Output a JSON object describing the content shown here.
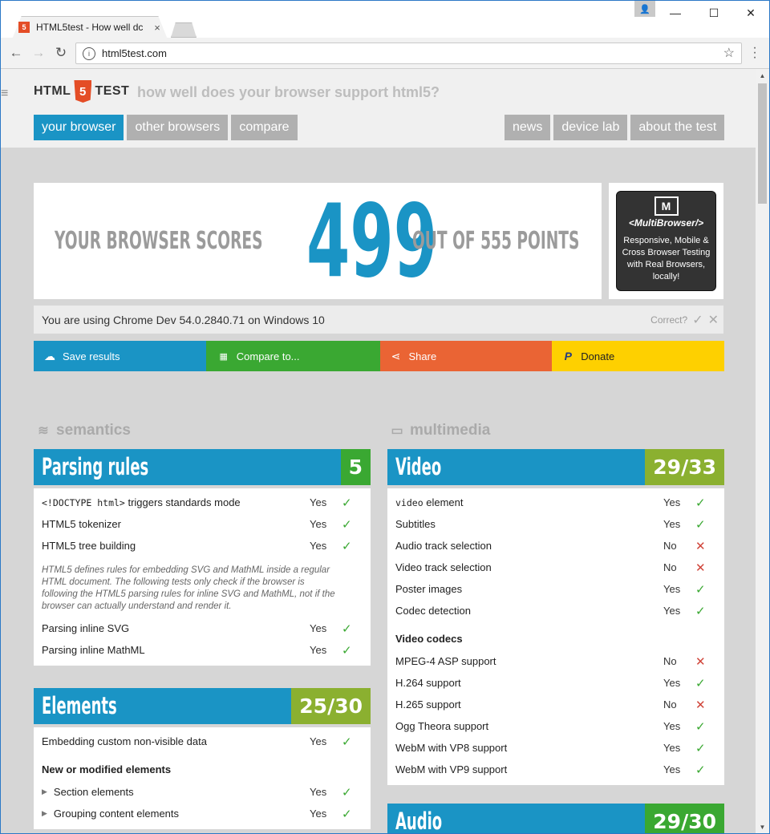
{
  "browser": {
    "tab_title": "HTML5test - How well dc",
    "tab_favicon": "5",
    "url": "html5test.com",
    "window_controls": {
      "minimize": "—",
      "maximize": "☐",
      "close": "✕"
    }
  },
  "site": {
    "logo_left": "HTML",
    "logo_badge": "5",
    "logo_right": "TEST",
    "tagline": "how well does your browser support html5?",
    "nav_left": [
      "your browser",
      "other browsers",
      "compare"
    ],
    "nav_right": [
      "news",
      "device lab",
      "about the test"
    ]
  },
  "score": {
    "prefix": "YOUR BROWSER SCORES",
    "value": "499",
    "suffix": "OUT OF 555 POINTS"
  },
  "ad": {
    "logo": "M",
    "brand": "<MultiBrowser/>",
    "text": "Responsive, Mobile & Cross Browser Testing with Real Browsers, locally!"
  },
  "using": {
    "text": "You are using Chrome Dev 54.0.2840.71 on Windows 10",
    "correct_label": "Correct?"
  },
  "actions": [
    {
      "label": "Save results",
      "icon": "cloud-upload-icon",
      "color": "#1a94c5"
    },
    {
      "label": "Compare to...",
      "icon": "grid-icon",
      "color": "#3aa832"
    },
    {
      "label": "Share",
      "icon": "share-icon",
      "color": "#ea6434"
    },
    {
      "label": "Donate",
      "icon": "paypal-icon",
      "color": "#fed000"
    }
  ],
  "categories": {
    "semantics": "semantics",
    "multimedia": "multimedia"
  },
  "sections": {
    "parsing": {
      "title": "Parsing rules",
      "score": "5",
      "rows": [
        {
          "code": "<!DOCTYPE html>",
          "label": " triggers standards mode",
          "result": "Yes"
        },
        {
          "label": "HTML5 tokenizer",
          "result": "Yes"
        },
        {
          "label": "HTML5 tree building",
          "result": "Yes"
        }
      ],
      "note": "HTML5 defines rules for embedding SVG and MathML inside a regular HTML document. The following tests only check if the browser is following the HTML5 parsing rules for inline SVG and MathML, not if the browser can actually understand and render it.",
      "rows2": [
        {
          "label": "Parsing inline SVG",
          "result": "Yes"
        },
        {
          "label": "Parsing inline MathML",
          "result": "Yes"
        }
      ]
    },
    "elements": {
      "title": "Elements",
      "score": "25/30",
      "rows": [
        {
          "label": "Embedding custom non-visible data",
          "result": "Yes"
        }
      ],
      "subheading": "New or modified elements",
      "rows2": [
        {
          "label": "Section elements",
          "result": "Yes"
        },
        {
          "label": "Grouping content elements",
          "result": "Yes"
        }
      ]
    },
    "video": {
      "title": "Video",
      "score": "29/33",
      "rows": [
        {
          "code": "video",
          "label": " element",
          "result": "Yes"
        },
        {
          "label": "Subtitles",
          "result": "Yes"
        },
        {
          "label": "Audio track selection",
          "result": "No"
        },
        {
          "label": "Video track selection",
          "result": "No"
        },
        {
          "label": "Poster images",
          "result": "Yes"
        },
        {
          "label": "Codec detection",
          "result": "Yes"
        }
      ],
      "subheading": "Video codecs",
      "rows2": [
        {
          "label": "MPEG-4 ASP support",
          "result": "No"
        },
        {
          "label": "H.264 support",
          "result": "Yes"
        },
        {
          "label": "H.265 support",
          "result": "No"
        },
        {
          "label": "Ogg Theora support",
          "result": "Yes"
        },
        {
          "label": "WebM with VP8 support",
          "result": "Yes"
        },
        {
          "label": "WebM with VP9 support",
          "result": "Yes"
        }
      ]
    },
    "audio": {
      "title": "Audio",
      "score": "29/30"
    }
  },
  "colors": {
    "blue": "#1a94c5",
    "green": "#3aa832",
    "olive": "#8bb030",
    "orange": "#ea6434",
    "yellow": "#fed000",
    "no_red": "#d0453a"
  }
}
